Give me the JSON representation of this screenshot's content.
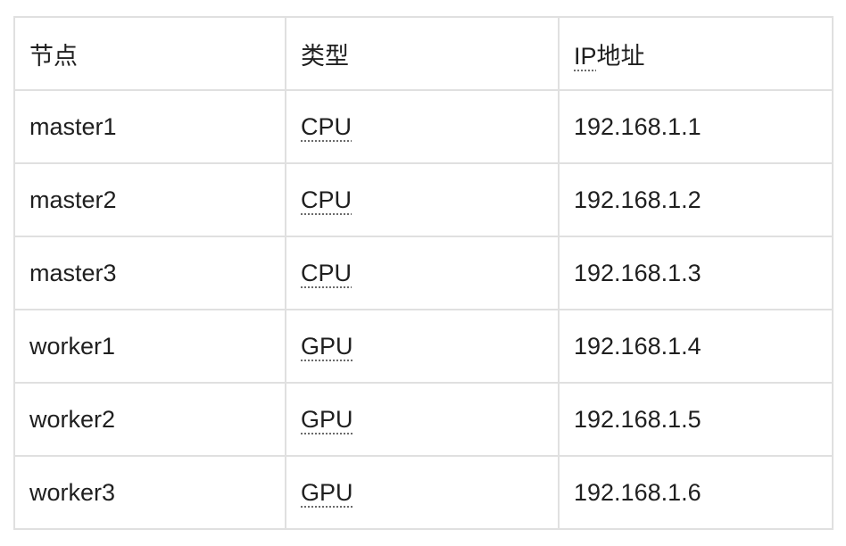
{
  "table": {
    "header": {
      "node": "节点",
      "type": "类型",
      "ip_abbr": "IP",
      "ip_rest": "地址"
    },
    "rows": [
      {
        "node": "master1",
        "type": "CPU",
        "ip": "192.168.1.1"
      },
      {
        "node": "master2",
        "type": "CPU",
        "ip": "192.168.1.2"
      },
      {
        "node": "master3",
        "type": "CPU",
        "ip": "192.168.1.3"
      },
      {
        "node": "worker1",
        "type": "GPU",
        "ip": "192.168.1.4"
      },
      {
        "node": "worker2",
        "type": "GPU",
        "ip": "192.168.1.5"
      },
      {
        "node": "worker3",
        "type": "GPU",
        "ip": "192.168.1.6"
      }
    ]
  },
  "colors": {
    "border": "#e0e0e0",
    "text": "#1f1f1f",
    "background": "#ffffff",
    "abbr_underline": "#6b6b6b"
  }
}
